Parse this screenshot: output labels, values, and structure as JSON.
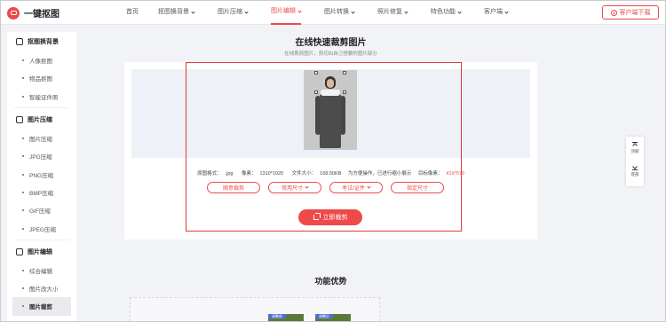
{
  "brand": {
    "name": "一键抠图",
    "accent": "#ee4a4a"
  },
  "nav": {
    "items": [
      {
        "label": "首页",
        "dropdown": false,
        "active": false
      },
      {
        "label": "抠图换背景",
        "dropdown": true,
        "active": false
      },
      {
        "label": "图片压缩",
        "dropdown": true,
        "active": false
      },
      {
        "label": "图片编辑",
        "dropdown": true,
        "active": true
      },
      {
        "label": "图片转换",
        "dropdown": true,
        "active": false
      },
      {
        "label": "照片修复",
        "dropdown": true,
        "active": false
      },
      {
        "label": "特色功能",
        "dropdown": true,
        "active": false
      },
      {
        "label": "客户端",
        "dropdown": true,
        "active": false
      }
    ],
    "download_label": "客户端下载"
  },
  "sidebar": {
    "groups": [
      {
        "title": "抠图换背景",
        "icon": "cutout-icon",
        "items": [
          "人像抠图",
          "物品抠图",
          "智能证件照"
        ]
      },
      {
        "title": "图片压缩",
        "icon": "compress-icon",
        "items": [
          "图片压缩",
          "JPG压缩",
          "PNG压缩",
          "BMP压缩",
          "GIF压缩",
          "JPEG压缩"
        ]
      },
      {
        "title": "图片编辑",
        "icon": "edit-icon",
        "items": [
          "综合编辑",
          "图片改大小",
          "图片裁剪"
        ]
      }
    ],
    "active_item": "图片裁剪"
  },
  "main": {
    "title": "在线快速裁剪图片",
    "subtitle": "在线裁剪图片，剪切出自己想要的图片部分",
    "info": {
      "format_label": "原图格式：",
      "format_value": ".jpg",
      "pixels_label": "像素：",
      "pixels_value": "1310*1920",
      "size_label": "文件大小：",
      "size_value": "168.50KB",
      "note": "为方便操作，已进行缩小展示",
      "target_label": "目标像素：",
      "target_value": "419*579"
    },
    "buttons": [
      {
        "label": "随意裁剪",
        "dropdown": false
      },
      {
        "label": "常用尺寸",
        "dropdown": true
      },
      {
        "label": "考试/证件",
        "dropdown": true
      },
      {
        "label": "指定尺寸",
        "dropdown": false
      }
    ],
    "crop_button": "立即裁剪",
    "section_title": "功能优势",
    "thumb_labels": [
      "调整前",
      "调整后"
    ]
  },
  "float_panel": {
    "top_label": "顶部",
    "bottom_label": "底部"
  }
}
